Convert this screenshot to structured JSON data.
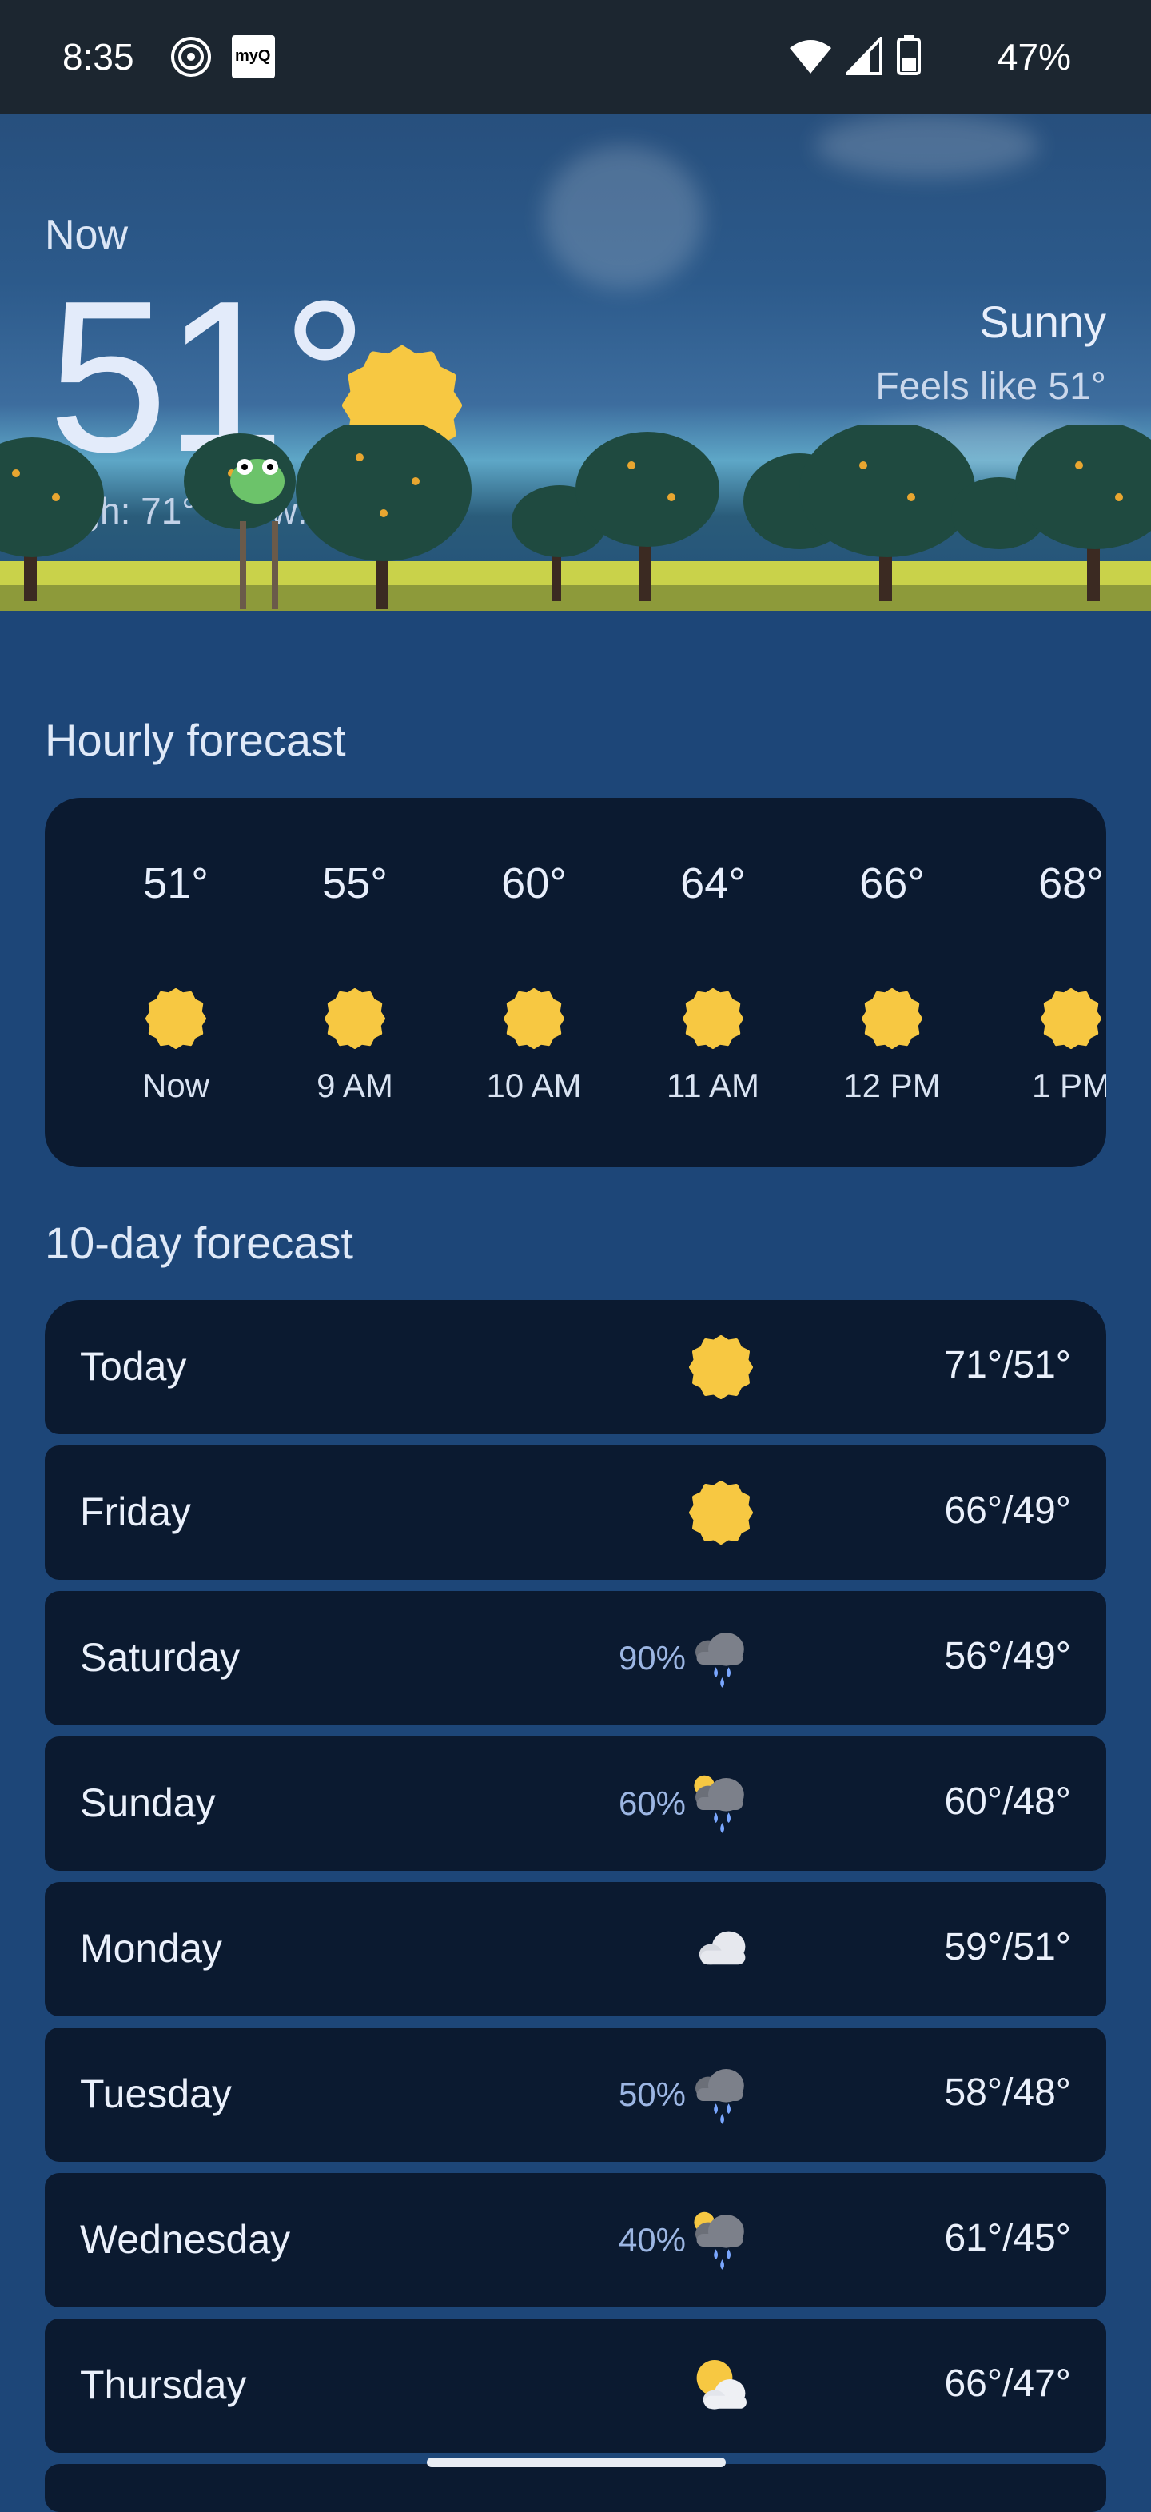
{
  "status_bar": {
    "time": "8:35",
    "battery": "47%",
    "app_icons": [
      "podcast-icon",
      "myq-icon"
    ],
    "myq_label": "myQ"
  },
  "current": {
    "label": "Now",
    "temperature": "51°",
    "condition": "Sunny",
    "feels_like": "Feels like 51°",
    "high_low": "High: 71° • Low: 51°",
    "icon": "sun-icon"
  },
  "hourly": {
    "title": "Hourly forecast",
    "items": [
      {
        "temp": "51°",
        "time": "Now",
        "icon": "sun-icon"
      },
      {
        "temp": "55°",
        "time": "9 AM",
        "icon": "sun-icon"
      },
      {
        "temp": "60°",
        "time": "10 AM",
        "icon": "sun-icon"
      },
      {
        "temp": "64°",
        "time": "11 AM",
        "icon": "sun-icon"
      },
      {
        "temp": "66°",
        "time": "12 PM",
        "icon": "sun-icon"
      },
      {
        "temp": "68°",
        "time": "1 PM",
        "icon": "sun-icon"
      }
    ]
  },
  "daily": {
    "title": "10-day forecast",
    "items": [
      {
        "day": "Today",
        "precip": "",
        "icon": "sun-icon",
        "temps": "71°/51°"
      },
      {
        "day": "Friday",
        "precip": "",
        "icon": "sun-icon",
        "temps": "66°/49°"
      },
      {
        "day": "Saturday",
        "precip": "90%",
        "icon": "rain-icon",
        "temps": "56°/49°"
      },
      {
        "day": "Sunday",
        "precip": "60%",
        "icon": "sun-rain-icon",
        "temps": "60°/48°"
      },
      {
        "day": "Monday",
        "precip": "",
        "icon": "cloud-icon",
        "temps": "59°/51°"
      },
      {
        "day": "Tuesday",
        "precip": "50%",
        "icon": "rain-icon",
        "temps": "58°/48°"
      },
      {
        "day": "Wednesday",
        "precip": "40%",
        "icon": "sun-rain-icon",
        "temps": "61°/45°"
      },
      {
        "day": "Thursday",
        "precip": "",
        "icon": "partly-cloudy-icon",
        "temps": "66°/47°"
      }
    ]
  },
  "colors": {
    "background": "#1d4678",
    "card": "#0b1a30",
    "sun": "#f7c842",
    "precip_text": "#9cb6e3"
  }
}
